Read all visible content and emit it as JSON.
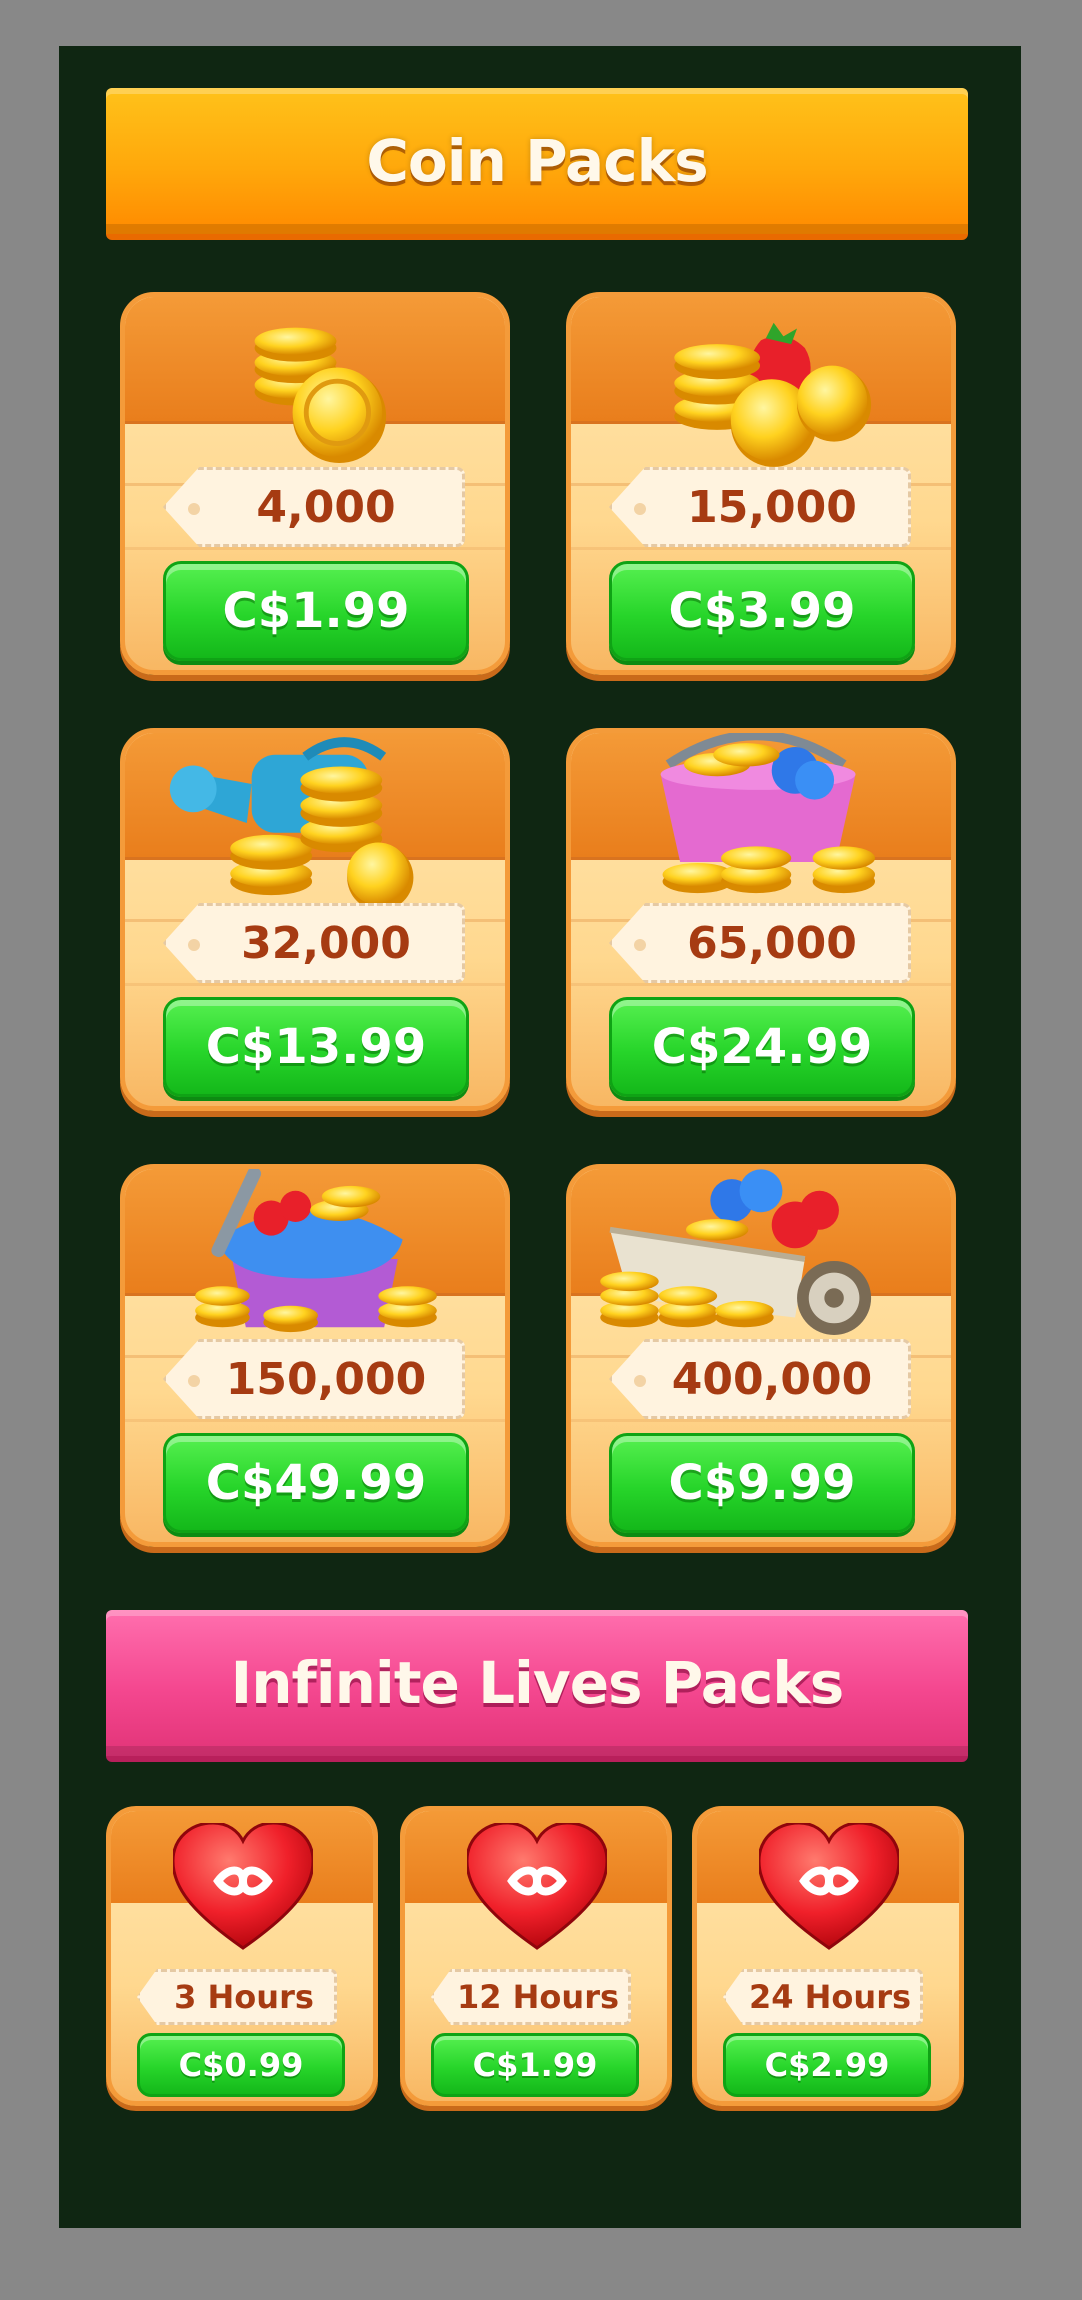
{
  "colors": {
    "background": "#888888",
    "panel": "#0f2612",
    "coin_banner": "#ffa80b",
    "lives_banner": "#f4478f",
    "price_button": "#27d52a",
    "tag_text": "#a63b12"
  },
  "coin_section": {
    "title": "Coin Packs",
    "packs": [
      {
        "amount": "4,000",
        "price": "C$1.99",
        "art": "coin-pile-icon"
      },
      {
        "amount": "15,000",
        "price": "C$3.99",
        "art": "coins-with-strawberry-icon"
      },
      {
        "amount": "32,000",
        "price": "C$13.99",
        "art": "watering-can-coins-icon"
      },
      {
        "amount": "65,000",
        "price": "C$24.99",
        "art": "bucket-of-coins-icon"
      },
      {
        "amount": "150,000",
        "price": "C$49.99",
        "art": "basket-of-coins-icon"
      },
      {
        "amount": "400,000",
        "price": "C$9.99",
        "art": "cart-of-coins-icon"
      }
    ]
  },
  "lives_section": {
    "title": "Infinite Lives Packs",
    "packs": [
      {
        "duration": "3 Hours",
        "price": "C$0.99",
        "art": "infinity-heart-icon"
      },
      {
        "duration": "12 Hours",
        "price": "C$1.99",
        "art": "infinity-heart-icon"
      },
      {
        "duration": "24 Hours",
        "price": "C$2.99",
        "art": "infinity-heart-icon"
      }
    ]
  }
}
